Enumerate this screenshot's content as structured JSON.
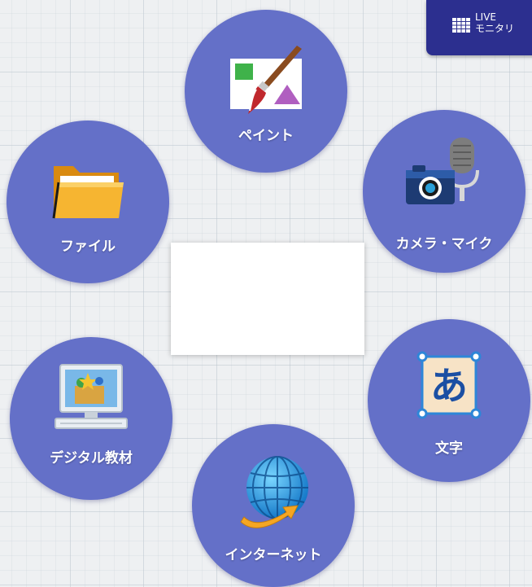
{
  "live_button": {
    "line1": "LIVE",
    "line2": "モニタリ",
    "icon": "grid-icon"
  },
  "menu": {
    "paint": {
      "label": "ペイント",
      "icon": "paint-brush-icon"
    },
    "camera": {
      "label": "カメラ・マイク",
      "icon": "camera-mic-icon"
    },
    "file": {
      "label": "ファイル",
      "icon": "folder-icon"
    },
    "moji": {
      "label": "文字",
      "icon": "character-a-icon",
      "glyph": "あ"
    },
    "digital": {
      "label": "デジタル教材",
      "icon": "computer-icon"
    },
    "internet": {
      "label": "インターネット",
      "icon": "globe-icon"
    }
  },
  "colors": {
    "circle": "#6470c8",
    "live_bg": "#2c2f8f",
    "background": "#eef0f2"
  }
}
